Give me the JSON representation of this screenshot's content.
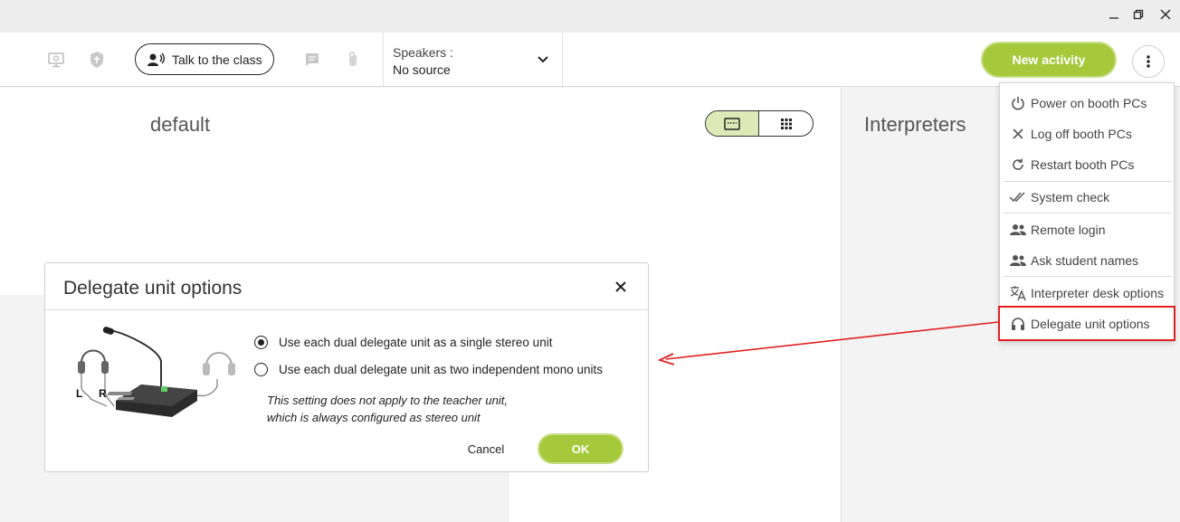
{
  "toolbar": {
    "talk_label": "Talk to the class",
    "speakers_label": "Speakers :",
    "speakers_value": "No source",
    "new_activity_label": "New activity"
  },
  "main": {
    "group_title": "default",
    "interpreters_title": "Interpreters"
  },
  "menu": {
    "items": [
      {
        "label": "Power on booth PCs",
        "icon": "power-icon"
      },
      {
        "label": "Log off booth PCs",
        "icon": "close-icon"
      },
      {
        "label": "Restart booth PCs",
        "icon": "refresh-icon"
      },
      {
        "label": "System check",
        "icon": "double-check-icon"
      },
      {
        "label": "Remote login",
        "icon": "users-icon"
      },
      {
        "label": "Ask student names",
        "icon": "users-icon"
      },
      {
        "label": "Interpreter desk options",
        "icon": "translate-icon"
      },
      {
        "label": "Delegate unit options",
        "icon": "headphones-icon"
      }
    ],
    "highlighted": "Delegate unit options",
    "highlight_color": "#e02020"
  },
  "dialog": {
    "title": "Delegate unit options",
    "illustration_labels": {
      "left": "L",
      "right": "R"
    },
    "options": [
      {
        "label": "Use each dual delegate unit as a single stereo unit",
        "selected": true
      },
      {
        "label": "Use each dual delegate unit as two independent mono units",
        "selected": false
      }
    ],
    "note_line1": "This setting does not apply to the teacher unit,",
    "note_line2": "which is always configured as stereo unit",
    "cancel_label": "Cancel",
    "ok_label": "OK"
  },
  "colors": {
    "accent": "#a5c93b",
    "accent_light": "#dde9b6"
  }
}
